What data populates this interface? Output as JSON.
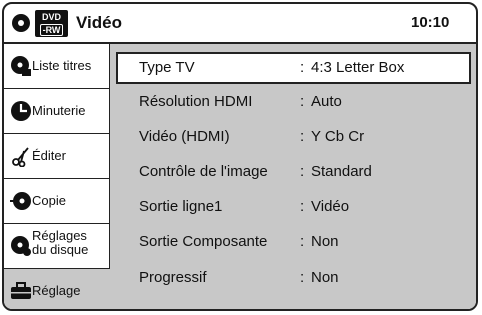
{
  "header": {
    "badge_top": "DVD",
    "badge_bottom": "-RW",
    "title": "Vidéo",
    "time": "10:10"
  },
  "sidebar": {
    "items": [
      {
        "label": "Liste titres",
        "icon": "disc-title-list-icon"
      },
      {
        "label": "Minuterie",
        "icon": "timer-clock-icon"
      },
      {
        "label": "Éditer",
        "icon": "edit-scissors-icon"
      },
      {
        "label": "Copie",
        "icon": "copy-disc-icon"
      },
      {
        "label_line1": "Réglages",
        "label_line2": "du disque",
        "icon": "disc-settings-icon"
      },
      {
        "label": "Réglage",
        "icon": "toolbox-icon",
        "active": true
      }
    ]
  },
  "settings": {
    "rows": [
      {
        "label": "Type TV",
        "sep": ":",
        "value": "4:3 Letter Box",
        "selected": true
      },
      {
        "label": "Résolution HDMI",
        "sep": ":",
        "value": "Auto"
      },
      {
        "label": "Vidéo (HDMI)",
        "sep": ":",
        "value": "Y Cb Cr"
      },
      {
        "label": "Contrôle de l'image",
        "sep": ":",
        "value": "Standard"
      },
      {
        "label": "Sortie ligne1",
        "sep": ":",
        "value": "Vidéo"
      },
      {
        "label": "Sortie Composante",
        "sep": ":",
        "value": "Non"
      },
      {
        "label": "Progressif",
        "sep": ":",
        "value": "Non"
      }
    ]
  },
  "colors": {
    "panel": "#c8c8c8",
    "border": "#222222",
    "background": "#ffffff"
  }
}
